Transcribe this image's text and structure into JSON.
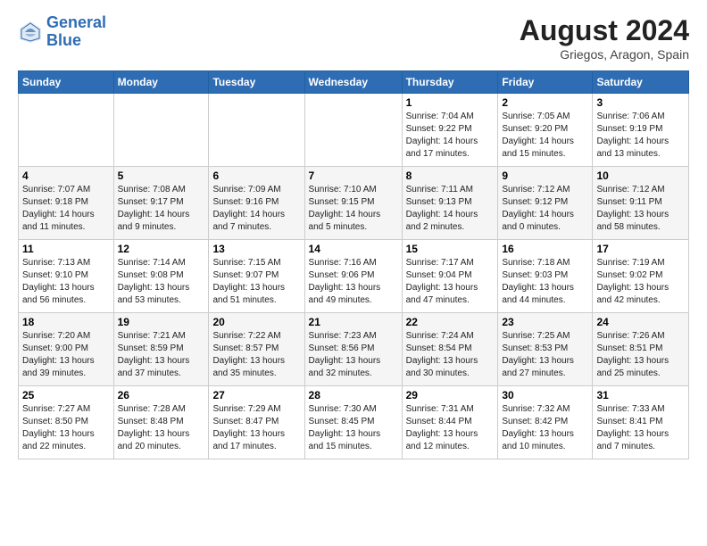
{
  "header": {
    "logo_line1": "General",
    "logo_line2": "Blue",
    "month_year": "August 2024",
    "location": "Griegos, Aragon, Spain"
  },
  "weekdays": [
    "Sunday",
    "Monday",
    "Tuesday",
    "Wednesday",
    "Thursday",
    "Friday",
    "Saturday"
  ],
  "weeks": [
    [
      {
        "day": "",
        "info": ""
      },
      {
        "day": "",
        "info": ""
      },
      {
        "day": "",
        "info": ""
      },
      {
        "day": "",
        "info": ""
      },
      {
        "day": "1",
        "info": "Sunrise: 7:04 AM\nSunset: 9:22 PM\nDaylight: 14 hours\nand 17 minutes."
      },
      {
        "day": "2",
        "info": "Sunrise: 7:05 AM\nSunset: 9:20 PM\nDaylight: 14 hours\nand 15 minutes."
      },
      {
        "day": "3",
        "info": "Sunrise: 7:06 AM\nSunset: 9:19 PM\nDaylight: 14 hours\nand 13 minutes."
      }
    ],
    [
      {
        "day": "4",
        "info": "Sunrise: 7:07 AM\nSunset: 9:18 PM\nDaylight: 14 hours\nand 11 minutes."
      },
      {
        "day": "5",
        "info": "Sunrise: 7:08 AM\nSunset: 9:17 PM\nDaylight: 14 hours\nand 9 minutes."
      },
      {
        "day": "6",
        "info": "Sunrise: 7:09 AM\nSunset: 9:16 PM\nDaylight: 14 hours\nand 7 minutes."
      },
      {
        "day": "7",
        "info": "Sunrise: 7:10 AM\nSunset: 9:15 PM\nDaylight: 14 hours\nand 5 minutes."
      },
      {
        "day": "8",
        "info": "Sunrise: 7:11 AM\nSunset: 9:13 PM\nDaylight: 14 hours\nand 2 minutes."
      },
      {
        "day": "9",
        "info": "Sunrise: 7:12 AM\nSunset: 9:12 PM\nDaylight: 14 hours\nand 0 minutes."
      },
      {
        "day": "10",
        "info": "Sunrise: 7:12 AM\nSunset: 9:11 PM\nDaylight: 13 hours\nand 58 minutes."
      }
    ],
    [
      {
        "day": "11",
        "info": "Sunrise: 7:13 AM\nSunset: 9:10 PM\nDaylight: 13 hours\nand 56 minutes."
      },
      {
        "day": "12",
        "info": "Sunrise: 7:14 AM\nSunset: 9:08 PM\nDaylight: 13 hours\nand 53 minutes."
      },
      {
        "day": "13",
        "info": "Sunrise: 7:15 AM\nSunset: 9:07 PM\nDaylight: 13 hours\nand 51 minutes."
      },
      {
        "day": "14",
        "info": "Sunrise: 7:16 AM\nSunset: 9:06 PM\nDaylight: 13 hours\nand 49 minutes."
      },
      {
        "day": "15",
        "info": "Sunrise: 7:17 AM\nSunset: 9:04 PM\nDaylight: 13 hours\nand 47 minutes."
      },
      {
        "day": "16",
        "info": "Sunrise: 7:18 AM\nSunset: 9:03 PM\nDaylight: 13 hours\nand 44 minutes."
      },
      {
        "day": "17",
        "info": "Sunrise: 7:19 AM\nSunset: 9:02 PM\nDaylight: 13 hours\nand 42 minutes."
      }
    ],
    [
      {
        "day": "18",
        "info": "Sunrise: 7:20 AM\nSunset: 9:00 PM\nDaylight: 13 hours\nand 39 minutes."
      },
      {
        "day": "19",
        "info": "Sunrise: 7:21 AM\nSunset: 8:59 PM\nDaylight: 13 hours\nand 37 minutes."
      },
      {
        "day": "20",
        "info": "Sunrise: 7:22 AM\nSunset: 8:57 PM\nDaylight: 13 hours\nand 35 minutes."
      },
      {
        "day": "21",
        "info": "Sunrise: 7:23 AM\nSunset: 8:56 PM\nDaylight: 13 hours\nand 32 minutes."
      },
      {
        "day": "22",
        "info": "Sunrise: 7:24 AM\nSunset: 8:54 PM\nDaylight: 13 hours\nand 30 minutes."
      },
      {
        "day": "23",
        "info": "Sunrise: 7:25 AM\nSunset: 8:53 PM\nDaylight: 13 hours\nand 27 minutes."
      },
      {
        "day": "24",
        "info": "Sunrise: 7:26 AM\nSunset: 8:51 PM\nDaylight: 13 hours\nand 25 minutes."
      }
    ],
    [
      {
        "day": "25",
        "info": "Sunrise: 7:27 AM\nSunset: 8:50 PM\nDaylight: 13 hours\nand 22 minutes."
      },
      {
        "day": "26",
        "info": "Sunrise: 7:28 AM\nSunset: 8:48 PM\nDaylight: 13 hours\nand 20 minutes."
      },
      {
        "day": "27",
        "info": "Sunrise: 7:29 AM\nSunset: 8:47 PM\nDaylight: 13 hours\nand 17 minutes."
      },
      {
        "day": "28",
        "info": "Sunrise: 7:30 AM\nSunset: 8:45 PM\nDaylight: 13 hours\nand 15 minutes."
      },
      {
        "day": "29",
        "info": "Sunrise: 7:31 AM\nSunset: 8:44 PM\nDaylight: 13 hours\nand 12 minutes."
      },
      {
        "day": "30",
        "info": "Sunrise: 7:32 AM\nSunset: 8:42 PM\nDaylight: 13 hours\nand 10 minutes."
      },
      {
        "day": "31",
        "info": "Sunrise: 7:33 AM\nSunset: 8:41 PM\nDaylight: 13 hours\nand 7 minutes."
      }
    ]
  ]
}
